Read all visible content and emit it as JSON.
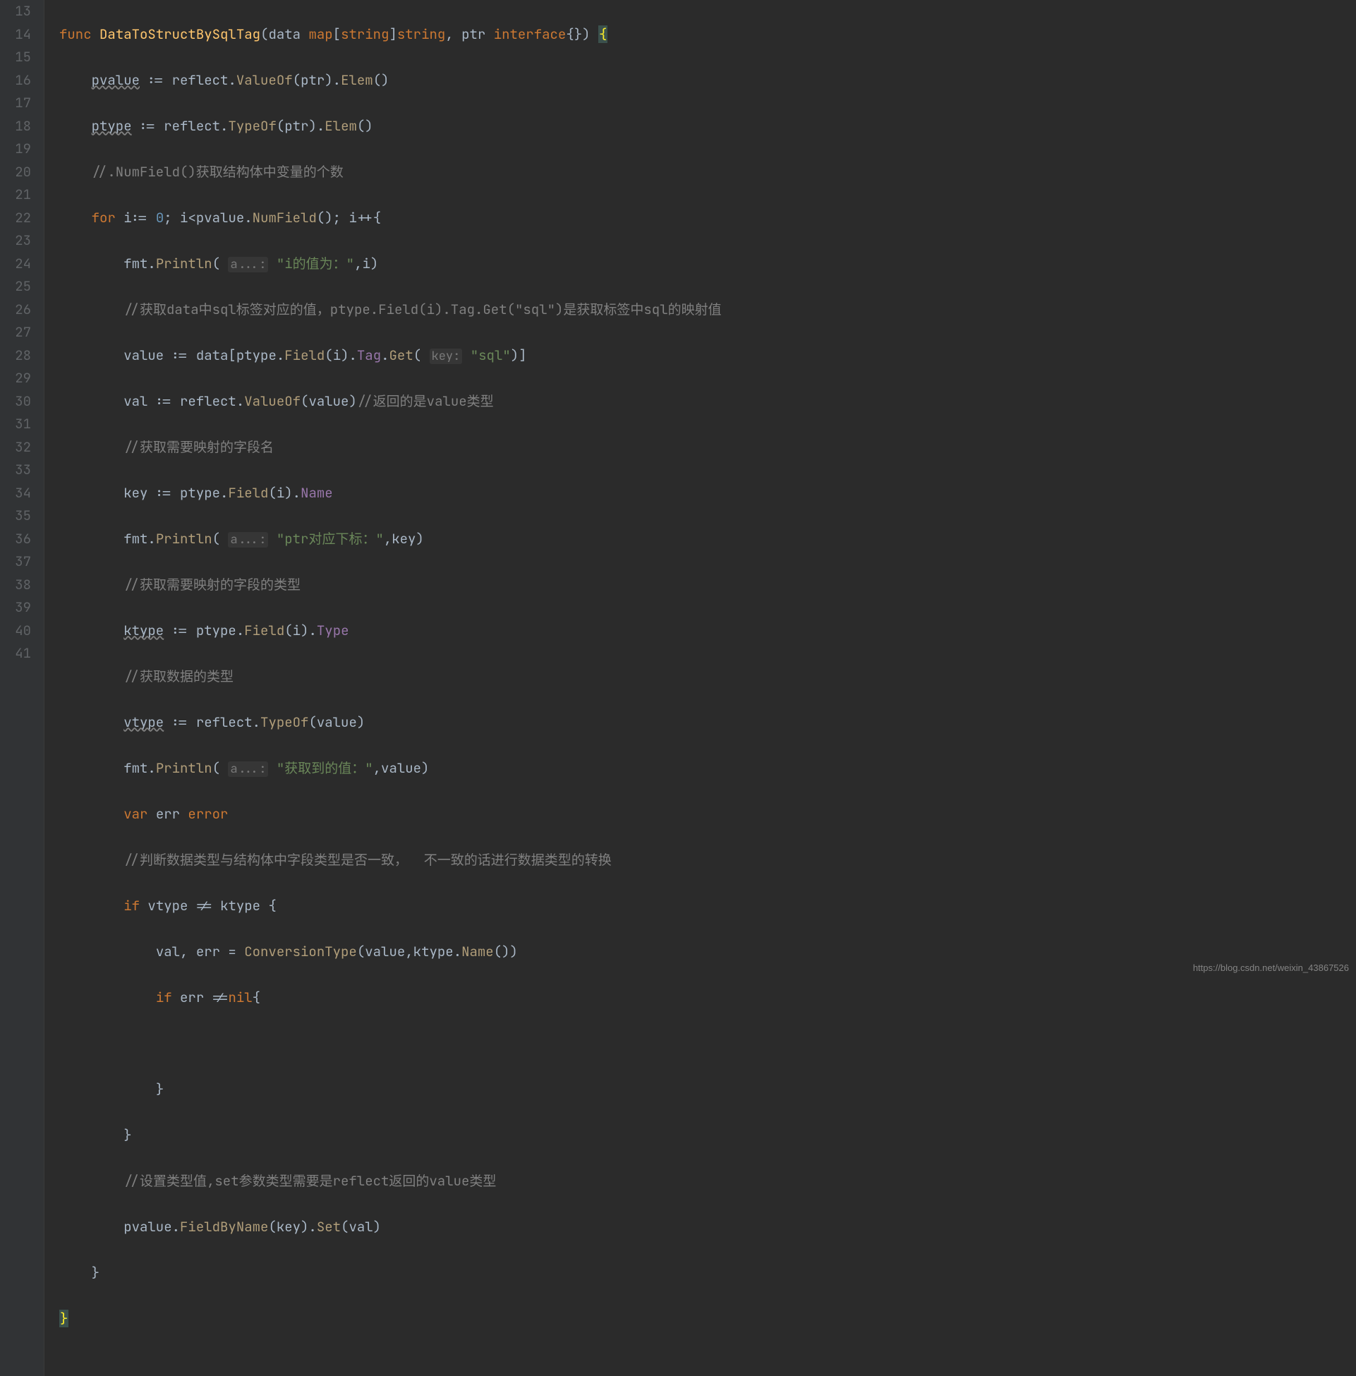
{
  "line_numbers": [
    "13",
    "14",
    "15",
    "16",
    "17",
    "18",
    "19",
    "20",
    "21",
    "22",
    "23",
    "24",
    "25",
    "26",
    "27",
    "28",
    "29",
    "30",
    "31",
    "32",
    "33",
    "34",
    "35",
    "36",
    "37",
    "38",
    "39",
    "40",
    "41"
  ],
  "watermark": "https://blog.csdn.net/weixin_43867526",
  "code_lines": {
    "l13": {
      "kw_func": "func",
      "func_name": "DataToStructBySqlTag",
      "p1": "data",
      "t_map": "map",
      "t_string1": "string",
      "t_string2": "string",
      "sep": ", ",
      "p2": "ptr",
      "t_iface": "interface",
      "empty": "{}",
      "paren_close": ") ",
      "brace": "{"
    },
    "l14": {
      "indent": "    ",
      "var": "pvalue",
      "op": " := ",
      "obj": "reflect",
      "m1": "ValueOf",
      "arg": "ptr",
      "m2": "Elem"
    },
    "l15": {
      "indent": "    ",
      "var": "ptype",
      "op": " := ",
      "obj": "reflect",
      "m1": "TypeOf",
      "arg": "ptr",
      "m2": "Elem"
    },
    "l16": {
      "indent": "    ",
      "comment": "//.NumField()获取结构体中变量的个数"
    },
    "l17": {
      "indent": "    ",
      "kw": "for",
      "var": "i",
      "op1": ":= ",
      "zero": "0",
      "sep1": "; ",
      "cond_var": "i",
      "lt": "<",
      "obj": "pvalue",
      "m": "NumField",
      "sep2": "(); ",
      "inc": "i++",
      "brace": "{"
    },
    "l18": {
      "indent": "        ",
      "obj": "fmt",
      "m": "Println",
      "hint": "a...:",
      "str": "\"i的值为：\"",
      "arg": ",i)"
    },
    "l19": {
      "indent": "        ",
      "comment": "//获取data中sql标签对应的值，ptype.Field(i).Tag.Get(\"sql\")是获取标签中sql的映射值"
    },
    "l20": {
      "indent": "        ",
      "var": "value",
      "op": " := ",
      "arr": "data",
      "obj": "ptype",
      "m1": "Field",
      "arg1": "i",
      "f": "Tag",
      "m2": "Get",
      "hint": "key:",
      "str": "\"sql\""
    },
    "l21": {
      "indent": "        ",
      "var": "val",
      "op": " := ",
      "obj": "reflect",
      "m": "ValueOf",
      "arg": "value",
      "comment": "//返回的是value类型"
    },
    "l22": {
      "indent": "        ",
      "comment": "//获取需要映射的字段名"
    },
    "l23": {
      "indent": "        ",
      "var": "key",
      "op": " := ",
      "obj": "ptype",
      "m": "Field",
      "arg": "i",
      "f": "Name"
    },
    "l24": {
      "indent": "        ",
      "obj": "fmt",
      "m": "Println",
      "hint": "a...:",
      "str": "\"ptr对应下标：\"",
      "arg": ",key)"
    },
    "l25": {
      "indent": "        ",
      "comment": "//获取需要映射的字段的类型"
    },
    "l26": {
      "indent": "        ",
      "var": "ktype",
      "op": " := ",
      "obj": "ptype",
      "m": "Field",
      "arg": "i",
      "f": "Type"
    },
    "l27": {
      "indent": "        ",
      "comment": "//获取数据的类型"
    },
    "l28": {
      "indent": "        ",
      "var": "vtype",
      "op": " := ",
      "obj": "reflect",
      "m": "TypeOf",
      "arg": "value"
    },
    "l29": {
      "indent": "        ",
      "obj": "fmt",
      "m": "Println",
      "hint": "a...:",
      "str": "\"获取到的值：\"",
      "arg": ",value)"
    },
    "l30": {
      "indent": "        ",
      "kw": "var",
      "var": "err",
      "type": "error"
    },
    "l31": {
      "indent": "        ",
      "comment": "//判断数据类型与结构体中字段类型是否一致，  不一致的话进行数据类型的转换"
    },
    "l32": {
      "indent": "        ",
      "kw": "if",
      "v1": "vtype",
      "op": "!=",
      "v2": "ktype",
      "brace": "{"
    },
    "l33": {
      "indent": "            ",
      "v1": "val",
      "sep": ", ",
      "v2": "err",
      "op": " = ",
      "fn": "ConversionType",
      "a1": "value",
      "a2": "ktype",
      "m": "Name"
    },
    "l34": {
      "indent": "            ",
      "kw": "if",
      "v": "err",
      "op": "!=",
      "nil": "nil",
      "brace": "{"
    },
    "l35": {
      "indent": ""
    },
    "l36": {
      "indent": "            ",
      "brace": "}"
    },
    "l37": {
      "indent": "        ",
      "brace": "}"
    },
    "l38": {
      "indent": "        ",
      "comment": "//设置类型值,set参数类型需要是reflect返回的value类型"
    },
    "l39": {
      "indent": "        ",
      "obj": "pvalue",
      "m1": "FieldByName",
      "arg1": "key",
      "m2": "Set",
      "arg2": "val"
    },
    "l40": {
      "indent": "    ",
      "brace": "}"
    },
    "l41": {
      "brace": "}"
    }
  }
}
